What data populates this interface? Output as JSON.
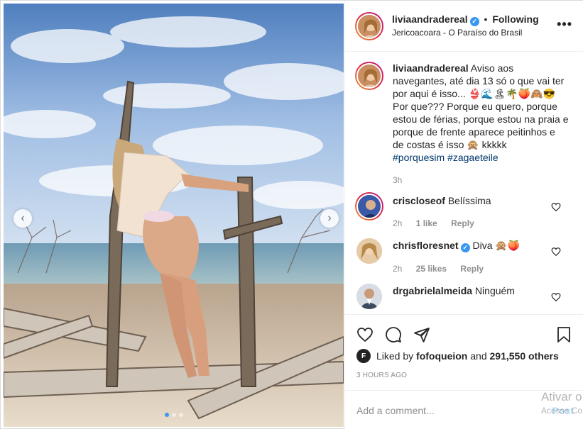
{
  "post": {
    "author": "livia​andradereal",
    "verified_mark": "✓",
    "separator": "•",
    "follow_state": "Following",
    "location": "Jericoacoara - O Paraíso do Brasil",
    "more_glyph": "•••"
  },
  "caption": {
    "username": "liviaandradereal",
    "text": "Aviso aos navegantes, até dia 13 só o que vai ter por aqui é isso... 👙🌊🏝🌴🍑🙈😎 Por que??? Porque eu quero, porque estou de férias, porque estou na praia e porque de frente aparece peitinhos e de costas é isso 🙊 kkkkk",
    "hashtags": [
      "#porquesim",
      "#zagaeteile"
    ],
    "time": "3h"
  },
  "comments": [
    {
      "username": "criscloseof",
      "verified": false,
      "text": "Belíssima",
      "time": "2h",
      "likes": "1 like",
      "reply": "Reply"
    },
    {
      "username": "chrisfloresnet",
      "verified": true,
      "text": "Diva 🙊🍑",
      "time": "2h",
      "likes": "25 likes",
      "reply": "Reply"
    },
    {
      "username": "drgabrielalmeida",
      "verified": false,
      "text": "Ninguém",
      "time": "",
      "likes": "",
      "reply": ""
    }
  ],
  "likes": {
    "prefix": "Liked by",
    "user": "fofoqueion",
    "joiner": "and",
    "others": "291,550 others",
    "avatar_letter": "F"
  },
  "timestamp": "3 HOURS AGO",
  "add_comment": {
    "placeholder": "Add a comment...",
    "post_label": "Post"
  },
  "carousel": {
    "prev": "‹",
    "next": "›",
    "count": 3,
    "active_index": 0
  },
  "watermark": {
    "line1": "Ativar o",
    "line2": "Acesse Co"
  },
  "icons": {
    "like": "heart-icon",
    "comment": "comment-icon",
    "share": "share-icon",
    "save": "bookmark-icon"
  }
}
